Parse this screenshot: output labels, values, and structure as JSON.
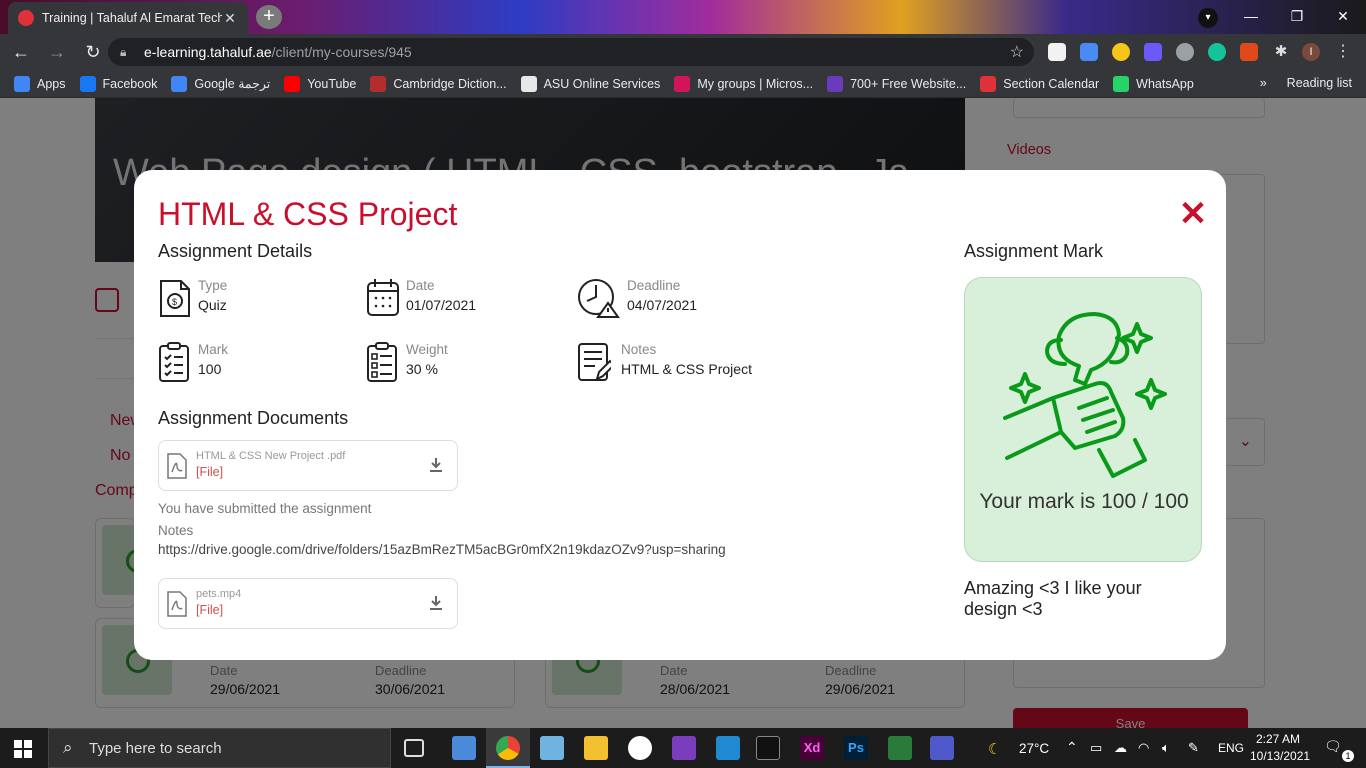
{
  "browser": {
    "tab_title": "Training | Tahaluf Al Emarat Techn",
    "url_host": "e-learning.tahaluf.ae",
    "url_path": "/client/my-courses/945",
    "profile_initial": "I"
  },
  "bookmarks": [
    {
      "label": "Apps",
      "color": "#4285f4"
    },
    {
      "label": "Facebook",
      "color": "#1877f2"
    },
    {
      "label": "Google ترجمة",
      "color": "#4285f4"
    },
    {
      "label": "YouTube",
      "color": "#ff0000"
    },
    {
      "label": "Cambridge Diction...",
      "color": "#b32d2d"
    },
    {
      "label": "ASU Online Services",
      "color": "#e8e8e8"
    },
    {
      "label": "My groups | Micros...",
      "color": "#d4145a"
    },
    {
      "label": "700+ Free Website...",
      "color": "#6a3bbd"
    },
    {
      "label": "Section Calendar",
      "color": "#e0303a"
    },
    {
      "label": "WhatsApp",
      "color": "#25d366"
    }
  ],
  "bookmarks_more": "»",
  "reading_list": "Reading list",
  "page": {
    "hero_title": "Web Page design ( HTML , CSS, bootstrap , Ja",
    "side_videos": "Videos",
    "side_items": [
      "New",
      "No",
      "Comp"
    ],
    "cards": [
      {
        "date_label": "Date",
        "date": "29/06/2021",
        "deadline_label": "Deadline",
        "deadline": "30/06/2021"
      },
      {
        "date_label": "Date",
        "date": "28/06/2021",
        "deadline_label": "Deadline",
        "deadline": "29/06/2021"
      }
    ],
    "save_label": "Save"
  },
  "modal": {
    "title": "HTML & CSS Project",
    "details_heading": "Assignment Details",
    "details": {
      "type": {
        "label": "Type",
        "value": "Quiz"
      },
      "date": {
        "label": "Date",
        "value": "01/07/2021"
      },
      "deadline": {
        "label": "Deadline",
        "value": "04/07/2021"
      },
      "mark": {
        "label": "Mark",
        "value": "100"
      },
      "weight": {
        "label": "Weight",
        "value": "30 %"
      },
      "notes": {
        "label": "Notes",
        "value": "HTML & CSS Project"
      }
    },
    "documents_heading": "Assignment Documents",
    "documents": [
      {
        "name": "HTML & CSS New Project .pdf",
        "file": "[File]"
      },
      {
        "name": "pets.mp4",
        "file": "[File]"
      }
    ],
    "submitted_text": "You have submitted the assignment",
    "notes_label": "Notes",
    "notes_link": "https://drive.google.com/drive/folders/15azBmRezTM5acBGr0mfX2n19kdazOZv9?usp=sharing",
    "mark_heading": "Assignment Mark",
    "mark_text": "Your mark is 100 / 100",
    "comment": "Amazing <3 I like your design <3",
    "accent_color": "#c8102e",
    "mark_color": "#0a9a1a"
  },
  "taskbar": {
    "search_placeholder": "Type here to search",
    "temperature": "27°C",
    "language": "ENG",
    "time": "2:27 AM",
    "date": "10/13/2021",
    "notification_count": "1"
  }
}
